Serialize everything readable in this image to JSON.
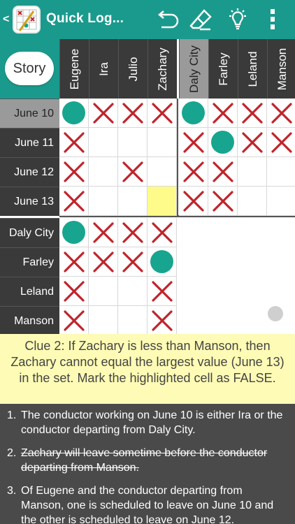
{
  "app": {
    "back_glyph": "<",
    "title": "Quick Log...",
    "actions": [
      "undo-icon",
      "eraser-icon",
      "lightbulb-icon",
      "more-vertical-icon"
    ]
  },
  "grid": {
    "story_label": "Story",
    "columns": [
      "Eugene",
      "Ira",
      "Julio",
      "Zachary",
      "Daly City",
      "Farley",
      "Leland",
      "Manson"
    ],
    "selected_column": "Daly City",
    "top_rows": [
      "June 10",
      "June 11",
      "June 12",
      "June 13"
    ],
    "selected_row": "June 10",
    "bottom_rows": [
      "Daly City",
      "Farley",
      "Leland",
      "Manson"
    ],
    "top_cells": [
      [
        "O",
        "X",
        "X",
        "X",
        "O",
        "X",
        "X",
        "X"
      ],
      [
        "X",
        "",
        "",
        "",
        "X",
        "O",
        "X",
        "X"
      ],
      [
        "X",
        "",
        "X",
        "",
        "X",
        "X",
        "",
        ""
      ],
      [
        "X",
        "",
        "",
        "H",
        "X",
        "X",
        "",
        ""
      ]
    ],
    "bottom_cells": [
      [
        "O",
        "X",
        "X",
        "X"
      ],
      [
        "X",
        "X",
        "X",
        "O"
      ],
      [
        "X",
        "",
        "",
        "X"
      ],
      [
        "X",
        "",
        "",
        "X"
      ]
    ],
    "colors": {
      "teal": "#1a9a8c",
      "mark_x": "#c0242b",
      "dot": "#17a58f",
      "highlight": "#fffb8a"
    }
  },
  "clue": {
    "text": "Clue 2: If Zachary is less than Manson, then Zachary cannot equal the largest value (June 13) in the set. Mark the highlighted cell as FALSE."
  },
  "clues": [
    {
      "num": "1.",
      "text": "The conductor working on June 10 is either Ira or the conductor departing from Daly City.",
      "done": false
    },
    {
      "num": "2.",
      "text": "Zachary will leave sometime before the conductor departing from Manson.",
      "done": true
    },
    {
      "num": "3.",
      "text": "Of Eugene and the conductor departing from Manson, one is scheduled to leave on June 10 and the other is scheduled to leave on June 12.",
      "done": false
    }
  ]
}
